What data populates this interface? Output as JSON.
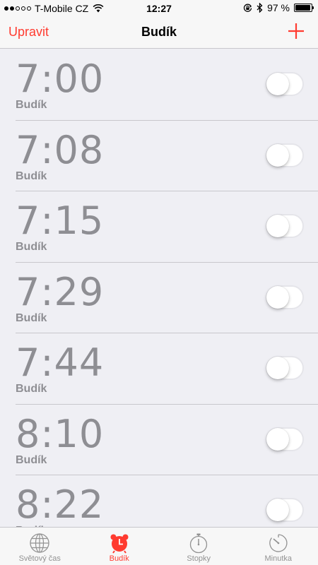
{
  "status": {
    "carrier": "T-Mobile CZ",
    "time": "12:27",
    "battery": "97 %",
    "battery_level": 0.97,
    "signal_bars": 2
  },
  "nav": {
    "edit_label": "Upravit",
    "title": "Budík",
    "add_icon": "plus-icon"
  },
  "alarms": [
    {
      "time": "7:00",
      "label": "Budík",
      "enabled": false
    },
    {
      "time": "7:08",
      "label": "Budík",
      "enabled": false
    },
    {
      "time": "7:15",
      "label": "Budík",
      "enabled": false
    },
    {
      "time": "7:29",
      "label": "Budík",
      "enabled": false
    },
    {
      "time": "7:44",
      "label": "Budík",
      "enabled": false
    },
    {
      "time": "8:10",
      "label": "Budík",
      "enabled": false
    },
    {
      "time": "8:22",
      "label": "Budík",
      "enabled": false
    }
  ],
  "tabs": [
    {
      "label": "Světový čas",
      "icon": "globe-icon",
      "active": false
    },
    {
      "label": "Budík",
      "icon": "alarm-clock-icon",
      "active": true
    },
    {
      "label": "Stopky",
      "icon": "stopwatch-icon",
      "active": false
    },
    {
      "label": "Minutka",
      "icon": "timer-icon",
      "active": false
    }
  ],
  "colors": {
    "accent": "#ff3b30",
    "inactive_text": "#8e8e93",
    "background": "#efeff4"
  }
}
